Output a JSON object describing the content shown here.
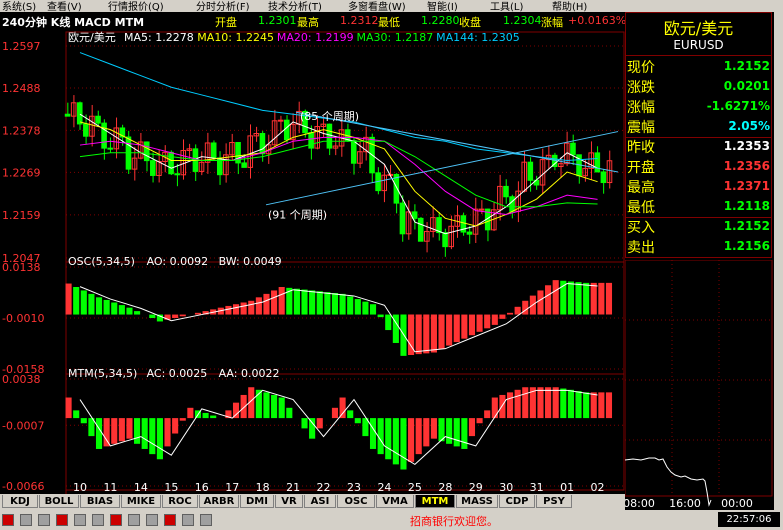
{
  "menu": [
    "系统(S)",
    "查看(V)",
    "行情报价(Q)",
    "分时分析(F)",
    "技术分析(T)",
    "多窗看盘(W)",
    "智能(I)",
    "工具(L)",
    "帮助(H)"
  ],
  "header": {
    "period_label": "240分钟 K线 MACD MTM",
    "open_label": "开盘",
    "open_value": "1.2301",
    "high_label": "最高",
    "high_value": "1.2312",
    "low_label": "最低",
    "low_value": "1.2280",
    "close_label": "收盘",
    "close_value": "1.2304",
    "change_label": "涨幅",
    "change_value": "+0.0163%"
  },
  "ma_legend": {
    "symbol": "欧元/美元",
    "items": [
      {
        "text": "MA5: 1.2278",
        "color": "#ffffff"
      },
      {
        "text": "MA10: 1.2245",
        "color": "#ffff00"
      },
      {
        "text": "MA20: 1.2199",
        "color": "#ff00ff"
      },
      {
        "text": "MA30: 1.2187",
        "color": "#00ff00"
      },
      {
        "text": "MA144: 1.2305",
        "color": "#00ccff"
      }
    ]
  },
  "osc_legend": {
    "name": "OSC(5,34,5)",
    "ao": "AO: 0.0092",
    "bw": "BW: 0.0049"
  },
  "mtm_legend": {
    "name": "MTM(5,34,5)",
    "ac": "AC: 0.0025",
    "aa": "AA: 0.0022"
  },
  "annotations": {
    "upper": "(85 个周期)",
    "lower": "(91 个周期)"
  },
  "price_axis": [
    "1.2597",
    "1.2488",
    "1.2378",
    "1.2269",
    "1.2159",
    "1.2047"
  ],
  "osc_axis": [
    "0.0138",
    "-0.0010",
    "-0.0158"
  ],
  "mtm_axis": [
    "0.0038",
    "-0.0007",
    "-0.0066"
  ],
  "x_axis": [
    "10",
    "11",
    "14",
    "15",
    "16",
    "17",
    "18",
    "21",
    "22",
    "23",
    "24",
    "25",
    "28",
    "29",
    "30",
    "31",
    "01",
    "02"
  ],
  "side_panel": {
    "title": "欧元/美元",
    "code": "EURUSD",
    "rows": [
      {
        "label": "现价",
        "value": "1.2152",
        "color": "#00ff00"
      },
      {
        "label": "涨跌",
        "value": "0.0201",
        "color": "#00ff00"
      },
      {
        "label": "涨幅",
        "value": "-1.6271%",
        "color": "#00ff00"
      },
      {
        "label": "震幅",
        "value": "2.05%",
        "color": "#00ffff"
      },
      {
        "label": "昨收",
        "value": "1.2353",
        "color": "#ffffff"
      },
      {
        "label": "开盘",
        "value": "1.2356",
        "color": "#ff3333"
      },
      {
        "label": "最高",
        "value": "1.2371",
        "color": "#ff3333"
      },
      {
        "label": "最低",
        "value": "1.2118",
        "color": "#00ff00"
      },
      {
        "label": "买入",
        "value": "1.2152",
        "color": "#00ff00"
      },
      {
        "label": "卖出",
        "value": "1.2156",
        "color": "#00ff00"
      }
    ],
    "mini_times": [
      "08:00",
      "16:00",
      "00:00"
    ]
  },
  "tabs": [
    "KDJ",
    "BOLL",
    "BIAS",
    "MIKE",
    "ROC",
    "ARBR",
    "DMI",
    "VR",
    "ASI",
    "OSC",
    "VMA",
    "MTM",
    "MASS",
    "CDP",
    "PSY"
  ],
  "active_tab": "MTM",
  "status": {
    "ticker": "招商银行欢迎您。",
    "clock": "22:57:06"
  },
  "colors": {
    "up": "#ff3333",
    "down": "#00ff00",
    "grid": "#800000",
    "axis_text": "#ff3333"
  },
  "chart_data": [
    {
      "type": "candlestick",
      "title": "欧元/美元",
      "ylim": [
        1.2047,
        1.2597
      ],
      "categories": [
        "10",
        "11",
        "14",
        "15",
        "16",
        "17",
        "18",
        "21",
        "22",
        "23",
        "24",
        "25",
        "28",
        "29",
        "30",
        "31",
        "01",
        "02"
      ],
      "series": [
        {
          "name": "MA5",
          "values": [
            1.242,
            1.237,
            1.232,
            1.228,
            1.231,
            1.23,
            1.233,
            1.24,
            1.237,
            1.235,
            1.229,
            1.214,
            1.211,
            1.213,
            1.218,
            1.225,
            1.232,
            1.228
          ]
        },
        {
          "name": "MA10",
          "values": [
            1.24,
            1.238,
            1.234,
            1.23,
            1.23,
            1.231,
            1.232,
            1.236,
            1.238,
            1.236,
            1.233,
            1.222,
            1.215,
            1.213,
            1.216,
            1.22,
            1.227,
            1.2245
          ]
        },
        {
          "name": "MA20",
          "values": [
            1.234,
            1.235,
            1.234,
            1.232,
            1.23,
            1.23,
            1.232,
            1.235,
            1.236,
            1.236,
            1.235,
            1.229,
            1.222,
            1.217,
            1.216,
            1.218,
            1.221,
            1.2199
          ]
        },
        {
          "name": "MA30",
          "values": [
            1.231,
            1.232,
            1.232,
            1.231,
            1.23,
            1.23,
            1.231,
            1.233,
            1.235,
            1.235,
            1.235,
            1.231,
            1.226,
            1.221,
            1.218,
            1.218,
            1.219,
            1.2187
          ]
        },
        {
          "name": "MA144",
          "values": [
            1.258,
            1.255,
            1.252,
            1.249,
            1.247,
            1.245,
            1.243,
            1.242,
            1.241,
            1.24,
            1.238,
            1.236,
            1.235,
            1.233,
            1.232,
            1.231,
            1.23,
            1.2305
          ]
        }
      ]
    },
    {
      "type": "bar",
      "title": "OSC(5,34,5)",
      "ylim": [
        -0.0158,
        0.0138
      ],
      "values": [
        0.009,
        0.005,
        0.002,
        -0.002,
        0.0,
        0.002,
        0.004,
        0.008,
        0.007,
        0.006,
        0.003,
        -0.012,
        -0.011,
        -0.007,
        -0.003,
        0.004,
        0.01,
        0.0092
      ]
    },
    {
      "type": "bar",
      "title": "MTM(5,34,5)",
      "ylim": [
        -0.0066,
        0.0038
      ],
      "values": [
        0.002,
        -0.003,
        -0.002,
        -0.004,
        0.001,
        0.0,
        0.003,
        0.002,
        -0.002,
        0.002,
        -0.003,
        -0.005,
        -0.002,
        -0.003,
        0.002,
        0.003,
        0.003,
        0.0025
      ]
    }
  ]
}
